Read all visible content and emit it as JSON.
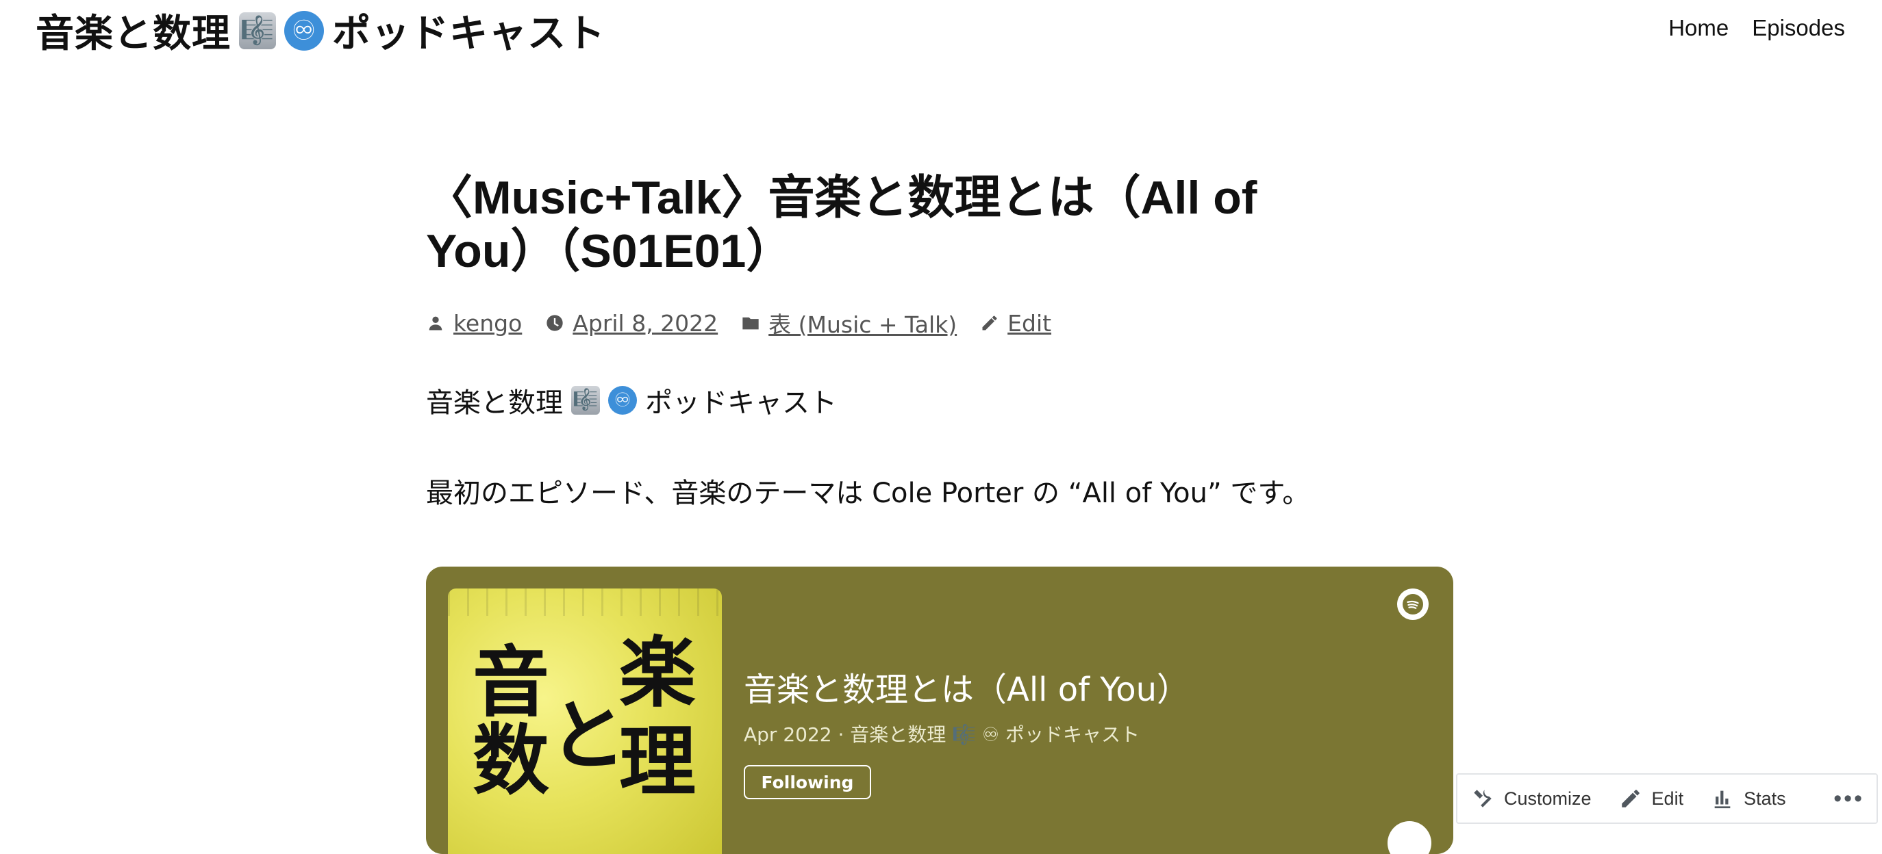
{
  "site": {
    "title_prefix": "音楽と数理",
    "title_suffix": "ポッドキャスト",
    "emoji_score": "🎼",
    "emoji_infinity": "♾"
  },
  "nav": {
    "items": [
      "Home",
      "Episodes"
    ]
  },
  "post": {
    "title": "〈Music+Talk〉音楽と数理とは（All of You）（S01E01）",
    "author": "kengo",
    "date": "April 8, 2022",
    "category": "表 (Music + Talk)",
    "edit_label": "Edit",
    "body_line1_prefix": "音楽と数理",
    "body_line1_suffix": "ポッドキャスト",
    "body_line2": "最初のエピソード、音楽のテーマは Cole Porter の “All of You” です。"
  },
  "player": {
    "bg_color": "#7b7633",
    "cover_text": [
      "音",
      "楽",
      "と",
      "数",
      "理"
    ],
    "episode_title": "音楽と数理とは（All of You）",
    "episode_subtitle": "Apr 2022 · 音楽と数理 🎼 ♾ ポッドキャスト",
    "follow_label": "Following"
  },
  "admin_bar": {
    "customize_label": "Customize",
    "edit_label": "Edit",
    "stats_label": "Stats",
    "more_label": "•••"
  }
}
